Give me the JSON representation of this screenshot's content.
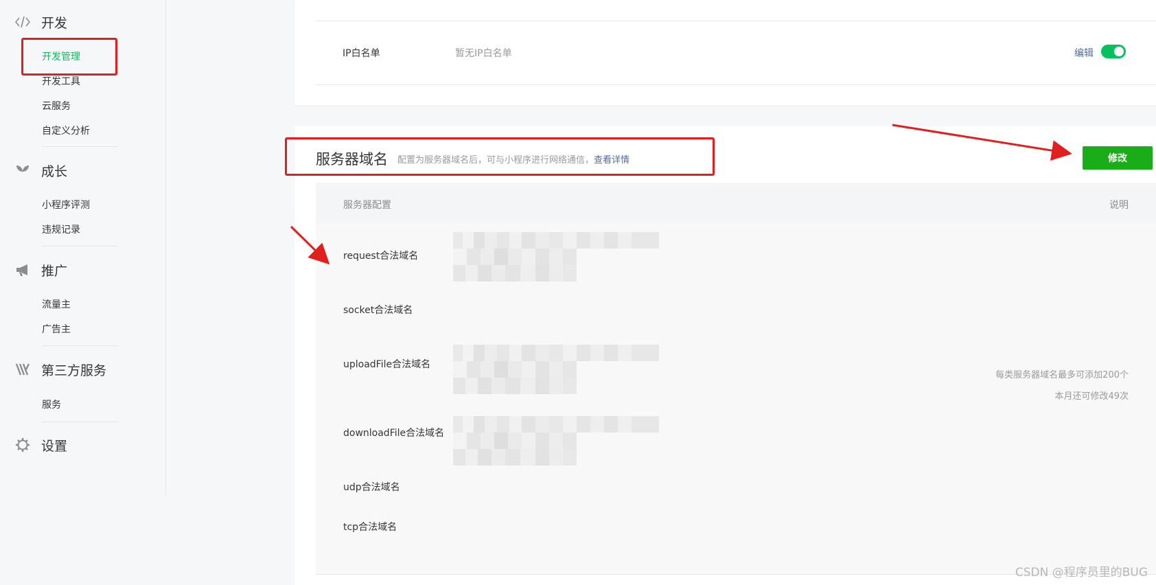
{
  "sidebar": {
    "groups": [
      {
        "title": "开发",
        "icon": "code-icon",
        "items": [
          "开发管理",
          "开发工具",
          "云服务",
          "自定义分析"
        ]
      },
      {
        "title": "成长",
        "icon": "leaf-icon",
        "items": [
          "小程序评测",
          "违规记录"
        ]
      },
      {
        "title": "推广",
        "icon": "megaphone-icon",
        "items": [
          "流量主",
          "广告主"
        ]
      },
      {
        "title": "第三方服务",
        "icon": "third-party-icon",
        "items": [
          "服务"
        ]
      },
      {
        "title": "设置",
        "icon": "gear-icon",
        "items": []
      }
    ],
    "active_item": "开发管理"
  },
  "ip_whitelist": {
    "label": "IP白名单",
    "value": "暂无IP白名单",
    "edit_label": "编辑",
    "toggle_on": true
  },
  "server_domain": {
    "title": "服务器域名",
    "description": "配置为服务器域名后，可与小程序进行网络通信，",
    "details_link": "查看详情",
    "modify_button": "修改",
    "table": {
      "col_config": "服务器配置",
      "col_note": "说明",
      "rows": [
        {
          "label": "request合法域名",
          "redacted": true
        },
        {
          "label": "socket合法域名",
          "redacted": false
        },
        {
          "label": "uploadFile合法域名",
          "redacted": true
        },
        {
          "label": "downloadFile合法域名",
          "redacted": true
        },
        {
          "label": "udp合法域名",
          "redacted": false
        },
        {
          "label": "tcp合法域名",
          "redacted": false
        }
      ],
      "notes": [
        "每类服务器域名最多可添加200个",
        "本月还可修改49次"
      ]
    }
  },
  "watermark": "CSDN @程序员里的BUG",
  "colors": {
    "accent_green": "#07c160",
    "button_green": "#1aad19",
    "link_blue": "#576b95",
    "annotation_red": "#e0201e"
  }
}
